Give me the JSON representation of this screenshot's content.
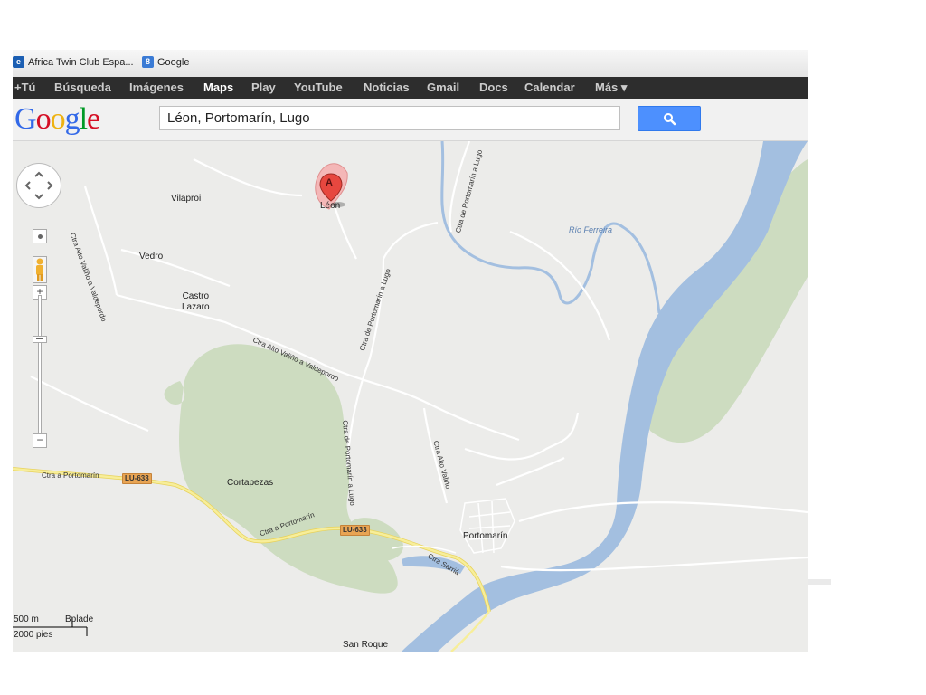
{
  "bookmarks": [
    {
      "label": "Africa Twin Club Espa...",
      "icon": "browser-favicon-icon"
    },
    {
      "label": "Google",
      "icon": "google-favicon-icon"
    }
  ],
  "nav": {
    "items": [
      "+Tú",
      "Búsqueda",
      "Imágenes",
      "Maps",
      "Play",
      "YouTube",
      "Noticias",
      "Gmail",
      "Docs",
      "Calendar",
      "Más ▾"
    ],
    "active": "Maps"
  },
  "search": {
    "logo": "Google",
    "query": "Léon, Portomarín, Lugo",
    "button_icon": "search-icon"
  },
  "map": {
    "marker": {
      "letter": "A",
      "label": "Léon"
    },
    "places": {
      "vilaproi": "Vilaproi",
      "vedro": "Vedro",
      "castro": "Castro\nLazaro",
      "cortapezas": "Cortapezas",
      "portomarin": "Portomarín",
      "san_roque": "San Roque"
    },
    "roads": {
      "valdeporto_a": "Ctra Alto Valiño a Valdepordo",
      "valdeporto_b": "Ctra Alto Valiño a Valdepordo",
      "portomarin_lugo_a": "Ctra de Portomarín a Lugo",
      "portomarin_lugo_b": "Ctra de Portomarín a Lugo",
      "portomarin_lugo_c": "Ctra de Portomarín a Lugo",
      "alto_valino": "Ctra Alto Valiño",
      "ctra_portomarin_a": "Ctra a Portomarín",
      "ctra_portomarin_b": "Ctra a Portomarín",
      "ctra_sarria": "Ctra Sarriá"
    },
    "river": "Río Ferreira",
    "shields": [
      "LU-633",
      "LU-633"
    ],
    "scale": {
      "metric": "500 m",
      "imperial": "2000 pies",
      "extra": "Bplade"
    }
  },
  "colors": {
    "water": "#a3bfe0",
    "park": "#cddcc0",
    "highway": "#f5e88f",
    "land": "#ececea",
    "nav_bg": "#2d2d2d",
    "search_button": "#4d90fe"
  }
}
